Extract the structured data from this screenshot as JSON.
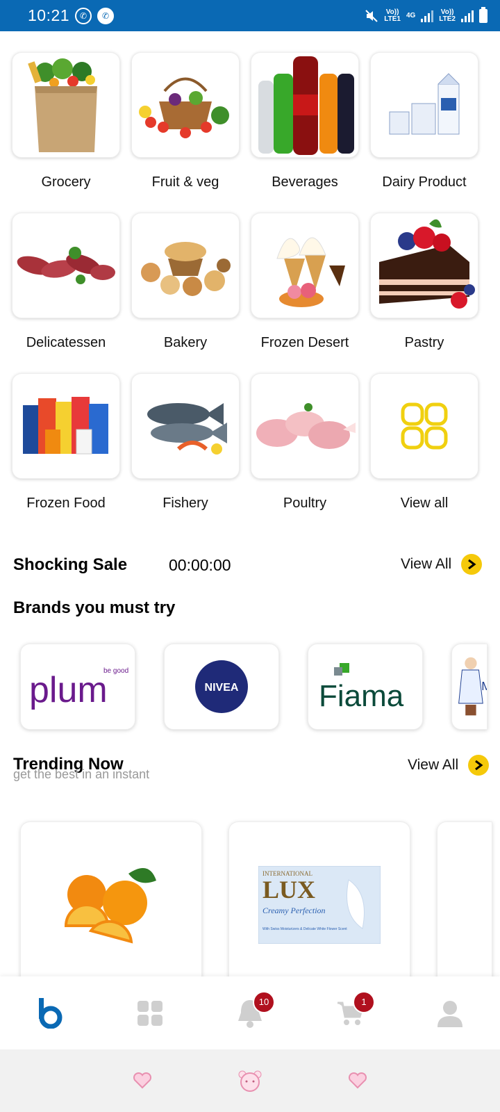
{
  "status_bar": {
    "time": "10:21",
    "sim1": {
      "top": "Vo))",
      "bottom": "LTE1"
    },
    "net_type": "4G",
    "sim2": {
      "top": "Vo))",
      "bottom": "LTE2"
    }
  },
  "categories": [
    {
      "label": "Grocery",
      "icon": "grocery-bag"
    },
    {
      "label": "Fruit & veg",
      "icon": "fruit-basket"
    },
    {
      "label": "Beverages",
      "icon": "bottles"
    },
    {
      "label": "Dairy Product",
      "icon": "milk-cartons"
    },
    {
      "label": "Delicatessen",
      "icon": "sausages"
    },
    {
      "label": "Bakery",
      "icon": "bread"
    },
    {
      "label": "Frozen Desert",
      "icon": "ice-cream"
    },
    {
      "label": "Pastry",
      "icon": "cake"
    },
    {
      "label": "Frozen Food",
      "icon": "packaged-food"
    },
    {
      "label": "Fishery",
      "icon": "fish"
    },
    {
      "label": "Poultry",
      "icon": "chicken"
    },
    {
      "label": "View all",
      "icon": "grid-icon"
    }
  ],
  "shocking_sale": {
    "title": "Shocking Sale",
    "timer": "00:00:00",
    "view_all": "View All"
  },
  "brands": {
    "title": "Brands you must try",
    "items": [
      {
        "name": "plum",
        "tagline": "be good",
        "color": "#6a1a8c"
      },
      {
        "name": "NIVEA",
        "color": "#1f2a78"
      },
      {
        "name": "Fiama",
        "color": "#0b4a3a"
      },
      {
        "name": "Amul",
        "color": "#1d3d8f"
      }
    ]
  },
  "trending": {
    "title": "Trending Now",
    "subtitle": "get the best in an instant",
    "view_all": "View All",
    "items": [
      {
        "image": "oranges"
      },
      {
        "image": "lux-soap",
        "brand": "LUX",
        "top_text": "INTERNATIONAL",
        "tagline": "Creamy Perfection",
        "small": "With Swiss Moisturizers & Delicate White Flower Scent"
      }
    ]
  },
  "bottom_nav": {
    "items": [
      {
        "name": "home",
        "active": true
      },
      {
        "name": "categories"
      },
      {
        "name": "notifications",
        "badge": "10"
      },
      {
        "name": "cart",
        "badge": "1"
      },
      {
        "name": "profile"
      }
    ],
    "accent": "#0a69b4",
    "inactive": "#cfcfcf",
    "badge_color": "#b0101e"
  },
  "colors": {
    "statusbar": "#0a69b4",
    "accent_yellow": "#f5c90a"
  }
}
